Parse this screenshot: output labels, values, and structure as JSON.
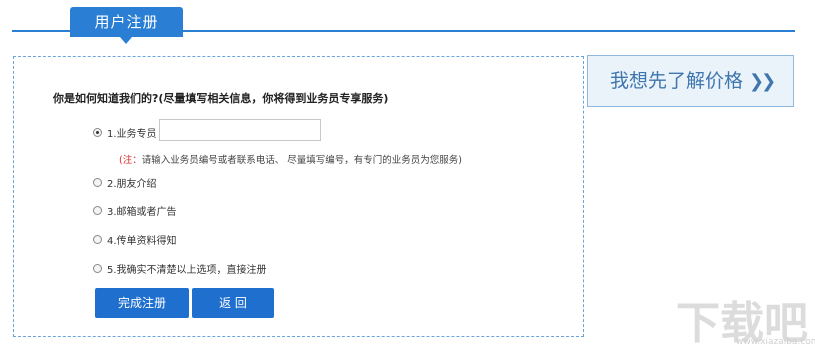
{
  "header": {
    "title": "用户注册"
  },
  "form": {
    "question": "你是如何知道我们的?(尽量填写相关信息，你将得到业务员专享服务)",
    "options": [
      {
        "label": "1.业务专员",
        "checked": true
      },
      {
        "label": "2.朋友介绍",
        "checked": false
      },
      {
        "label": "3.邮箱或者广告",
        "checked": false
      },
      {
        "label": "4.传单资料得知",
        "checked": false
      },
      {
        "label": "5.我确实不清楚以上选项，直接注册",
        "checked": false
      }
    ],
    "referral_input": {
      "value": "",
      "placeholder": ""
    },
    "note_prefix": "(注：",
    "note_text": "请输入业务员编号或者联系电话、 尽量填写编号，有专门的业务员为您服务)",
    "submit_label": "完成注册",
    "back_label": "返 回"
  },
  "sidebar": {
    "price_label": "我想先了解价格",
    "price_arrow": "❯❯"
  },
  "watermark": {
    "big": "下载吧",
    "small": "www.xiazaiba.com"
  }
}
